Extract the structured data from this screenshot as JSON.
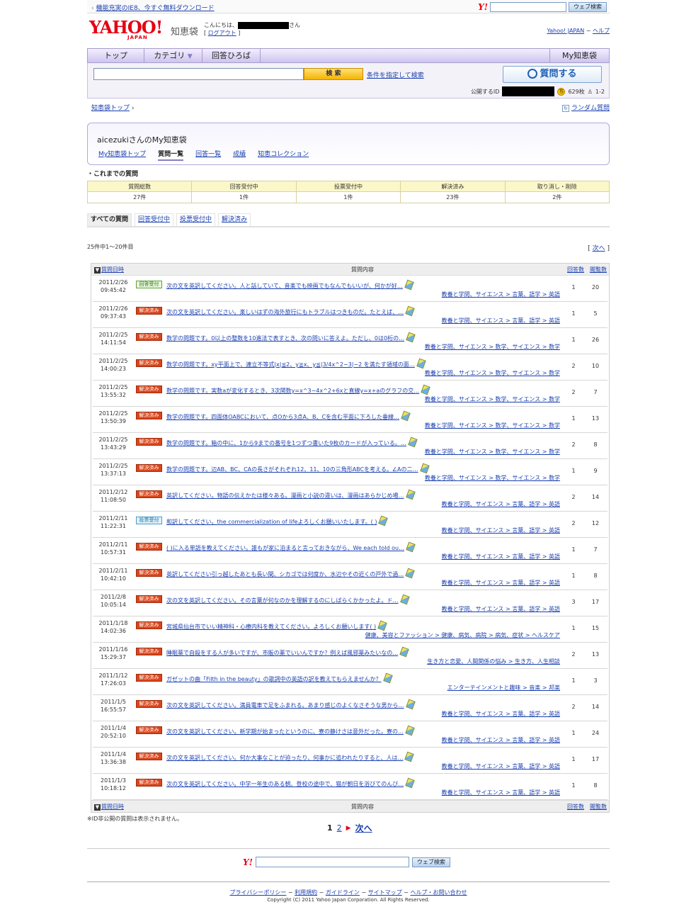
{
  "topbar": {
    "promo": "機能充実のIE8、今すぐ無料ダウンロード",
    "arrow": "›",
    "logo": "Y!",
    "search_button": "ウェブ検索"
  },
  "header": {
    "logo_text": "YAHOO!",
    "logo_sub": "JAPAN",
    "site_name": "知恵袋",
    "greeting_pre": "こんにちは、",
    "greeting_post": "さん",
    "logout": "ログアウト",
    "link_yahoo": "Yahoo! JAPAN",
    "link_help": "ヘルプ"
  },
  "nav": {
    "top": "トップ",
    "category": "カテゴリ",
    "category_arrow": "▼",
    "plaza": "回答ひろば",
    "my": "My知恵袋"
  },
  "search": {
    "button": "検 索",
    "advanced": "条件を指定して検索",
    "ask": "質問する",
    "public_id_label": "公開するID",
    "coins": "629枚",
    "coin_icon": "ち",
    "level": "1-2"
  },
  "breadcrumb": {
    "top": "知恵袋トップ",
    "arrow": "›",
    "random": "ランダム質問",
    "random_icon": "↻"
  },
  "mybox": {
    "title": "aicezukiさんのMy知恵袋",
    "tabs": [
      "My知恵袋トップ",
      "質問一覧",
      "回答一覧",
      "成績",
      "知恵コレクション"
    ]
  },
  "summary": {
    "heading": "・これまでの質問",
    "headers": [
      "質問総数",
      "回答受付中",
      "投票受付中",
      "解決済み",
      "取り消し・削除"
    ],
    "values": [
      "27件",
      "1件",
      "1件",
      "23件",
      "2件"
    ]
  },
  "filter_tabs": [
    "すべての質問",
    "回答受付中",
    "投票受付中",
    "解決済み"
  ],
  "listing": {
    "count": "25件中1～20件目",
    "next_top": "次へ",
    "bracket_l": "[",
    "bracket_r": "]"
  },
  "table": {
    "col_date": "質問日時",
    "col_content": "質問内容",
    "col_answers": "回答数",
    "col_views": "閲覧数",
    "sort_icon": "▼",
    "rows": [
      {
        "date": "2011/2/26",
        "time": "09:45:42",
        "status": "回答受付",
        "kind": "ans",
        "title": "次の文を英訳してください。人と話していて、音楽でも映画でもなんでもいいが、何かが好…",
        "cat": "教養と学問、サイエンス > 言葉、語学 > 英語",
        "answers": "1",
        "views": "20"
      },
      {
        "date": "2011/2/26",
        "time": "09:37:43",
        "status": "解決済み",
        "kind": "res",
        "title": "次の文を英訳してください。楽しいはずの海外旅行にもトラブルはつきものだ。たとえば、…",
        "cat": "教養と学問、サイエンス > 言葉、語学 > 英語",
        "answers": "1",
        "views": "5"
      },
      {
        "date": "2011/2/25",
        "time": "14:11:54",
        "status": "解決済み",
        "kind": "res",
        "title": "数学の問題です。0以上の整数を10進法で表すとき、次の問いに答えよ。ただし、0は0桁の…",
        "cat": "教養と学問、サイエンス > 数学、サイエンス > 数学",
        "answers": "1",
        "views": "26"
      },
      {
        "date": "2011/2/25",
        "time": "14:00:23",
        "status": "解決済み",
        "kind": "res",
        "title": "数学の問題です。xy平面上で、連立不等式|x|≦2、y≧x、y≦|3/4x^2−3|−2 を満たす領域の面…",
        "cat": "教養と学問、サイエンス > 数学、サイエンス > 数学",
        "answers": "2",
        "views": "10"
      },
      {
        "date": "2011/2/25",
        "time": "13:55:32",
        "status": "解決済み",
        "kind": "res",
        "title": "数学の問題です。実数aが変化するとき、3次関数y=x^3−4x^2+6xと直線y=x+aのグラフの交…",
        "cat": "教養と学問、サイエンス > 数学、サイエンス > 数学",
        "answers": "2",
        "views": "7"
      },
      {
        "date": "2011/2/25",
        "time": "13:50:39",
        "status": "解決済み",
        "kind": "res",
        "title": "数学の問題です。四面体OABCにおいて、点Oから3点A、B、Cを含む平面に下ろした垂線…",
        "cat": "教養と学問、サイエンス > 数学、サイエンス > 数学",
        "answers": "1",
        "views": "13"
      },
      {
        "date": "2011/2/25",
        "time": "13:43:29",
        "status": "解決済み",
        "kind": "res",
        "title": "数学の問題です。箱の中に、1から9までの番号を1つずつ書いた9枚のカードが入っている。…",
        "cat": "教養と学問、サイエンス > 数学、サイエンス > 数学",
        "answers": "2",
        "views": "8"
      },
      {
        "date": "2011/2/25",
        "time": "13:37:13",
        "status": "解決済み",
        "kind": "res",
        "title": "数学の問題です。辺AB、BC、CAの長さがそれぞれ12、11、10の三角形ABCを考える。∠Aの二…",
        "cat": "教養と学問、サイエンス > 数学、サイエンス > 数学",
        "answers": "1",
        "views": "9"
      },
      {
        "date": "2011/2/12",
        "time": "11:08:50",
        "status": "解決済み",
        "kind": "res",
        "title": "英訳してください。物語の伝えかたは様々ある。漫画と小説の違いは、漫画はあらかじめ場…",
        "cat": "教養と学問、サイエンス > 言葉、語学 > 英語",
        "answers": "2",
        "views": "14"
      },
      {
        "date": "2011/2/11",
        "time": "11:22:31",
        "status": "投票受付",
        "kind": "vote",
        "title": "和訳してください。the commercialization of lifeよろしくお願いいたします。( )",
        "cat": "教養と学問、サイエンス > 言葉、語学 > 英語",
        "answers": "2",
        "views": "12"
      },
      {
        "date": "2011/2/11",
        "time": "10:57:31",
        "status": "解決済み",
        "kind": "res",
        "title": "( )に入る単語を教えてください。誰もが家に泊まると言っておきながら、We each told ou…",
        "cat": "教養と学問、サイエンス > 言葉、語学 > 英語",
        "answers": "1",
        "views": "7"
      },
      {
        "date": "2011/2/11",
        "time": "10:42:10",
        "status": "解決済み",
        "kind": "res",
        "title": "英訳してください引っ越したあとも長い間、シカゴでは何度か、水辺やその近くの戸外で過…",
        "cat": "教養と学問、サイエンス > 言葉、語学 > 英語",
        "answers": "1",
        "views": "8"
      },
      {
        "date": "2011/2/8",
        "time": "10:05:14",
        "status": "解決済み",
        "kind": "res",
        "title": "次の文を英訳してください。その言葉が何なのかを理解するのにしばらくかかったよ。ド…",
        "cat": "教養と学問、サイエンス > 言葉、語学 > 英語",
        "answers": "3",
        "views": "17"
      },
      {
        "date": "2011/1/18",
        "time": "14:02:36",
        "status": "解決済み",
        "kind": "res",
        "title": "宮城県仙台市でいい精神科・心療内科を教えてください。よろしくお願いします( )",
        "cat": "健康、美容とファッション > 健康、病気、病院 > 病気、症状 > ヘルスケア",
        "answers": "1",
        "views": "15"
      },
      {
        "date": "2011/1/16",
        "time": "15:29:37",
        "status": "解決済み",
        "kind": "res",
        "title": "睡眠薬で自殺をする人が多いですが、市販の薬でいいんですか？例えば風邪薬みたいなの…",
        "cat": "生き方と恋愛、人間関係の悩み > 生き方、人生相談",
        "answers": "2",
        "views": "13"
      },
      {
        "date": "2011/1/12",
        "time": "17:26:03",
        "status": "解決済み",
        "kind": "res",
        "title": "ガゼットの曲「Filth in the beauty」の歌詞中の英語の訳を教えてもらえませんか？",
        "cat": "エンターテインメントと趣味 > 音楽 > 邦楽",
        "answers": "1",
        "views": "3"
      },
      {
        "date": "2011/1/5",
        "time": "16:55:57",
        "status": "解決済み",
        "kind": "res",
        "title": "次の文を英訳してください。満員電車で足をふまれる。あまり感じのよくなさそうな男から…",
        "cat": "教養と学問、サイエンス > 言葉、語学 > 英語",
        "answers": "2",
        "views": "14"
      },
      {
        "date": "2011/1/4",
        "time": "20:52:10",
        "status": "解決済み",
        "kind": "res",
        "title": "次の文を英訳してください。新学期が始まったというのに、寮の静けさは意外だった。寮の…",
        "cat": "教養と学問、サイエンス > 言葉、語学 > 英語",
        "answers": "1",
        "views": "24"
      },
      {
        "date": "2011/1/4",
        "time": "13:36:38",
        "status": "解決済み",
        "kind": "res",
        "title": "次の文を英訳してください。何か大事なことが迫ったり、何事かに追われたりすると、人は…",
        "cat": "教養と学問、サイエンス > 言葉、語学 > 英語",
        "answers": "1",
        "views": "17"
      },
      {
        "date": "2011/1/3",
        "time": "10:18:12",
        "status": "解決済み",
        "kind": "res",
        "title": "次の文を英訳してください。中学一年生のある朝、登校の途中で、猫が朝日を浴びてのんび…",
        "cat": "教養と学問、サイエンス > 言葉、語学 > 英語",
        "answers": "1",
        "views": "8"
      }
    ]
  },
  "note": "※ID非公開の質問は表示されません。",
  "pager": {
    "p1": "1",
    "p2": "2",
    "arrow": "▶",
    "next": "次へ"
  },
  "bottom_search": {
    "logo": "Y!",
    "button": "ウェブ検索"
  },
  "footer": {
    "links": [
      "プライバシーポリシー",
      "利用規約",
      "ガイドライン",
      "サイトマップ",
      "ヘルプ・お問い合わせ"
    ],
    "sep": " − ",
    "copyright": "Copyright (C) 2011 Yahoo Japan Corporation. All Rights Reserved."
  }
}
